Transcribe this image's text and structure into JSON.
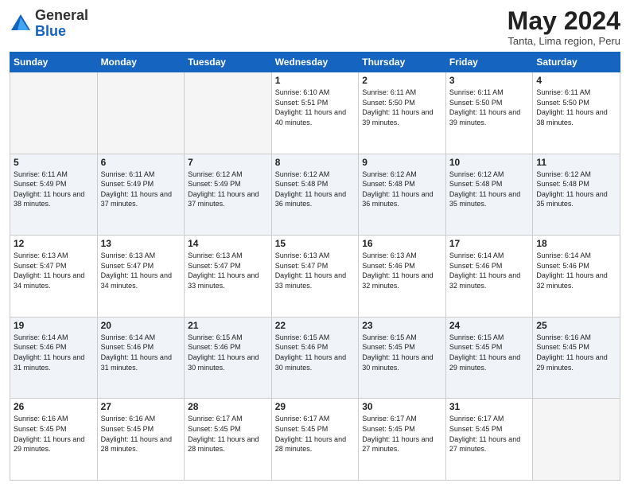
{
  "header": {
    "logo_line1": "General",
    "logo_line2": "Blue",
    "month_title": "May 2024",
    "location": "Tanta, Lima region, Peru"
  },
  "days_of_week": [
    "Sunday",
    "Monday",
    "Tuesday",
    "Wednesday",
    "Thursday",
    "Friday",
    "Saturday"
  ],
  "weeks": [
    [
      {
        "num": "",
        "sunrise": "",
        "sunset": "",
        "daylight": ""
      },
      {
        "num": "",
        "sunrise": "",
        "sunset": "",
        "daylight": ""
      },
      {
        "num": "",
        "sunrise": "",
        "sunset": "",
        "daylight": ""
      },
      {
        "num": "1",
        "sunrise": "Sunrise: 6:10 AM",
        "sunset": "Sunset: 5:51 PM",
        "daylight": "Daylight: 11 hours and 40 minutes."
      },
      {
        "num": "2",
        "sunrise": "Sunrise: 6:11 AM",
        "sunset": "Sunset: 5:50 PM",
        "daylight": "Daylight: 11 hours and 39 minutes."
      },
      {
        "num": "3",
        "sunrise": "Sunrise: 6:11 AM",
        "sunset": "Sunset: 5:50 PM",
        "daylight": "Daylight: 11 hours and 39 minutes."
      },
      {
        "num": "4",
        "sunrise": "Sunrise: 6:11 AM",
        "sunset": "Sunset: 5:50 PM",
        "daylight": "Daylight: 11 hours and 38 minutes."
      }
    ],
    [
      {
        "num": "5",
        "sunrise": "Sunrise: 6:11 AM",
        "sunset": "Sunset: 5:49 PM",
        "daylight": "Daylight: 11 hours and 38 minutes."
      },
      {
        "num": "6",
        "sunrise": "Sunrise: 6:11 AM",
        "sunset": "Sunset: 5:49 PM",
        "daylight": "Daylight: 11 hours and 37 minutes."
      },
      {
        "num": "7",
        "sunrise": "Sunrise: 6:12 AM",
        "sunset": "Sunset: 5:49 PM",
        "daylight": "Daylight: 11 hours and 37 minutes."
      },
      {
        "num": "8",
        "sunrise": "Sunrise: 6:12 AM",
        "sunset": "Sunset: 5:48 PM",
        "daylight": "Daylight: 11 hours and 36 minutes."
      },
      {
        "num": "9",
        "sunrise": "Sunrise: 6:12 AM",
        "sunset": "Sunset: 5:48 PM",
        "daylight": "Daylight: 11 hours and 36 minutes."
      },
      {
        "num": "10",
        "sunrise": "Sunrise: 6:12 AM",
        "sunset": "Sunset: 5:48 PM",
        "daylight": "Daylight: 11 hours and 35 minutes."
      },
      {
        "num": "11",
        "sunrise": "Sunrise: 6:12 AM",
        "sunset": "Sunset: 5:48 PM",
        "daylight": "Daylight: 11 hours and 35 minutes."
      }
    ],
    [
      {
        "num": "12",
        "sunrise": "Sunrise: 6:13 AM",
        "sunset": "Sunset: 5:47 PM",
        "daylight": "Daylight: 11 hours and 34 minutes."
      },
      {
        "num": "13",
        "sunrise": "Sunrise: 6:13 AM",
        "sunset": "Sunset: 5:47 PM",
        "daylight": "Daylight: 11 hours and 34 minutes."
      },
      {
        "num": "14",
        "sunrise": "Sunrise: 6:13 AM",
        "sunset": "Sunset: 5:47 PM",
        "daylight": "Daylight: 11 hours and 33 minutes."
      },
      {
        "num": "15",
        "sunrise": "Sunrise: 6:13 AM",
        "sunset": "Sunset: 5:47 PM",
        "daylight": "Daylight: 11 hours and 33 minutes."
      },
      {
        "num": "16",
        "sunrise": "Sunrise: 6:13 AM",
        "sunset": "Sunset: 5:46 PM",
        "daylight": "Daylight: 11 hours and 32 minutes."
      },
      {
        "num": "17",
        "sunrise": "Sunrise: 6:14 AM",
        "sunset": "Sunset: 5:46 PM",
        "daylight": "Daylight: 11 hours and 32 minutes."
      },
      {
        "num": "18",
        "sunrise": "Sunrise: 6:14 AM",
        "sunset": "Sunset: 5:46 PM",
        "daylight": "Daylight: 11 hours and 32 minutes."
      }
    ],
    [
      {
        "num": "19",
        "sunrise": "Sunrise: 6:14 AM",
        "sunset": "Sunset: 5:46 PM",
        "daylight": "Daylight: 11 hours and 31 minutes."
      },
      {
        "num": "20",
        "sunrise": "Sunrise: 6:14 AM",
        "sunset": "Sunset: 5:46 PM",
        "daylight": "Daylight: 11 hours and 31 minutes."
      },
      {
        "num": "21",
        "sunrise": "Sunrise: 6:15 AM",
        "sunset": "Sunset: 5:46 PM",
        "daylight": "Daylight: 11 hours and 30 minutes."
      },
      {
        "num": "22",
        "sunrise": "Sunrise: 6:15 AM",
        "sunset": "Sunset: 5:46 PM",
        "daylight": "Daylight: 11 hours and 30 minutes."
      },
      {
        "num": "23",
        "sunrise": "Sunrise: 6:15 AM",
        "sunset": "Sunset: 5:45 PM",
        "daylight": "Daylight: 11 hours and 30 minutes."
      },
      {
        "num": "24",
        "sunrise": "Sunrise: 6:15 AM",
        "sunset": "Sunset: 5:45 PM",
        "daylight": "Daylight: 11 hours and 29 minutes."
      },
      {
        "num": "25",
        "sunrise": "Sunrise: 6:16 AM",
        "sunset": "Sunset: 5:45 PM",
        "daylight": "Daylight: 11 hours and 29 minutes."
      }
    ],
    [
      {
        "num": "26",
        "sunrise": "Sunrise: 6:16 AM",
        "sunset": "Sunset: 5:45 PM",
        "daylight": "Daylight: 11 hours and 29 minutes."
      },
      {
        "num": "27",
        "sunrise": "Sunrise: 6:16 AM",
        "sunset": "Sunset: 5:45 PM",
        "daylight": "Daylight: 11 hours and 28 minutes."
      },
      {
        "num": "28",
        "sunrise": "Sunrise: 6:17 AM",
        "sunset": "Sunset: 5:45 PM",
        "daylight": "Daylight: 11 hours and 28 minutes."
      },
      {
        "num": "29",
        "sunrise": "Sunrise: 6:17 AM",
        "sunset": "Sunset: 5:45 PM",
        "daylight": "Daylight: 11 hours and 28 minutes."
      },
      {
        "num": "30",
        "sunrise": "Sunrise: 6:17 AM",
        "sunset": "Sunset: 5:45 PM",
        "daylight": "Daylight: 11 hours and 27 minutes."
      },
      {
        "num": "31",
        "sunrise": "Sunrise: 6:17 AM",
        "sunset": "Sunset: 5:45 PM",
        "daylight": "Daylight: 11 hours and 27 minutes."
      },
      {
        "num": "",
        "sunrise": "",
        "sunset": "",
        "daylight": ""
      }
    ]
  ]
}
